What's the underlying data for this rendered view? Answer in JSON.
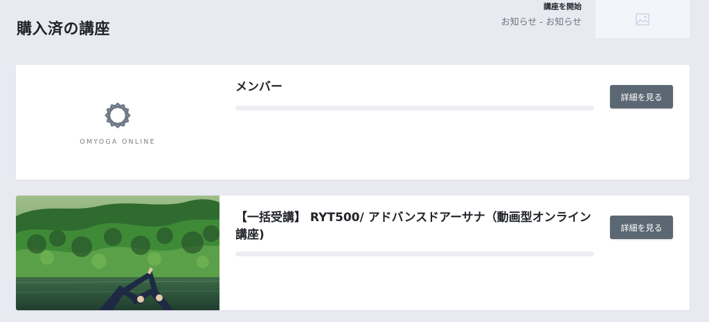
{
  "page": {
    "title": "購入済の講座"
  },
  "header": {
    "start_course_label": "講座を開始",
    "notice_breadcrumb": "お知らせ - お知らせ",
    "thumbnail_icon": "image-placeholder-icon"
  },
  "courses": [
    {
      "title": "メンバー",
      "logo_text": "OMYOGA ONLINE",
      "progress": 0,
      "button_label": "詳細を見る"
    },
    {
      "title": "【一括受講】 RYT500/ アドバンスドアーサナ（動画型オンライン講座)",
      "progress": 0,
      "button_label": "詳細を見る"
    }
  ],
  "colors": {
    "background": "#e9e9f2",
    "card": "#ffffff",
    "button": "#5b6874",
    "progress_track": "#eceef1",
    "logo": "#6f7a86"
  }
}
